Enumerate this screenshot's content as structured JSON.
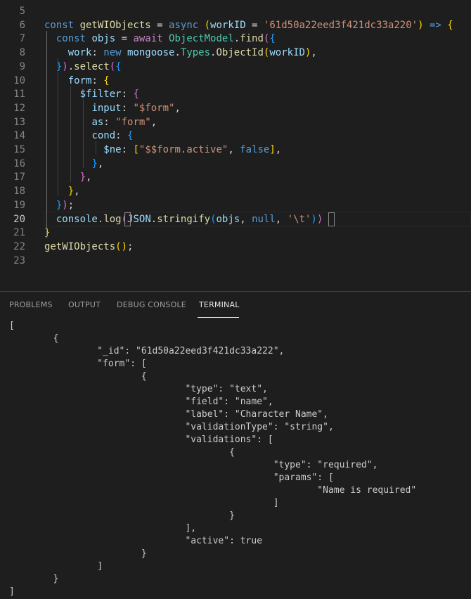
{
  "editor": {
    "active_line": "20",
    "lines": [
      {
        "num": "5",
        "tokens": []
      },
      {
        "num": "6",
        "tokens": [
          [
            "kw",
            "const "
          ],
          [
            "fn",
            "getWIObjects"
          ],
          [
            "pun",
            " = "
          ],
          [
            "kw",
            "async "
          ],
          [
            "b1",
            "("
          ],
          [
            "var",
            "workID"
          ],
          [
            "pun",
            " = "
          ],
          [
            "str",
            "'61d50a22eed3f421dc33a220'"
          ],
          [
            "b1",
            ")"
          ],
          [
            "kw",
            " => "
          ],
          [
            "b1",
            "{"
          ]
        ]
      },
      {
        "num": "7",
        "tokens": [
          [
            "pun",
            "  "
          ],
          [
            "kw",
            "const "
          ],
          [
            "var",
            "objs"
          ],
          [
            "pun",
            " = "
          ],
          [
            "ctl",
            "await "
          ],
          [
            "cls",
            "ObjectModel"
          ],
          [
            "pun",
            "."
          ],
          [
            "fn",
            "find"
          ],
          [
            "b2",
            "("
          ],
          [
            "b3",
            "{"
          ]
        ]
      },
      {
        "num": "8",
        "tokens": [
          [
            "pun",
            "    "
          ],
          [
            "var",
            "work"
          ],
          [
            "pun",
            ": "
          ],
          [
            "kw",
            "new "
          ],
          [
            "var",
            "mongoose"
          ],
          [
            "pun",
            "."
          ],
          [
            "cls",
            "Types"
          ],
          [
            "pun",
            "."
          ],
          [
            "fn",
            "ObjectId"
          ],
          [
            "b1",
            "("
          ],
          [
            "var",
            "workID"
          ],
          [
            "b1",
            ")"
          ],
          [
            "pun",
            ","
          ]
        ]
      },
      {
        "num": "9",
        "tokens": [
          [
            "pun",
            "  "
          ],
          [
            "b3",
            "}"
          ],
          [
            "b2",
            ")"
          ],
          [
            "pun",
            "."
          ],
          [
            "fn",
            "select"
          ],
          [
            "b2",
            "("
          ],
          [
            "b3",
            "{"
          ]
        ]
      },
      {
        "num": "10",
        "tokens": [
          [
            "pun",
            "    "
          ],
          [
            "var",
            "form"
          ],
          [
            "pun",
            ": "
          ],
          [
            "b1",
            "{"
          ]
        ]
      },
      {
        "num": "11",
        "tokens": [
          [
            "pun",
            "      "
          ],
          [
            "var",
            "$filter"
          ],
          [
            "pun",
            ": "
          ],
          [
            "b2",
            "{"
          ]
        ]
      },
      {
        "num": "12",
        "tokens": [
          [
            "pun",
            "        "
          ],
          [
            "var",
            "input"
          ],
          [
            "pun",
            ": "
          ],
          [
            "str",
            "\"$form\""
          ],
          [
            "pun",
            ","
          ]
        ]
      },
      {
        "num": "13",
        "tokens": [
          [
            "pun",
            "        "
          ],
          [
            "var",
            "as"
          ],
          [
            "pun",
            ": "
          ],
          [
            "str",
            "\"form\""
          ],
          [
            "pun",
            ","
          ]
        ]
      },
      {
        "num": "14",
        "tokens": [
          [
            "pun",
            "        "
          ],
          [
            "var",
            "cond"
          ],
          [
            "pun",
            ": "
          ],
          [
            "b3",
            "{"
          ]
        ]
      },
      {
        "num": "15",
        "tokens": [
          [
            "pun",
            "          "
          ],
          [
            "var",
            "$ne"
          ],
          [
            "pun",
            ": "
          ],
          [
            "b1",
            "["
          ],
          [
            "str",
            "\"$$form.active\""
          ],
          [
            "pun",
            ", "
          ],
          [
            "kw",
            "false"
          ],
          [
            "b1",
            "]"
          ],
          [
            "pun",
            ","
          ]
        ]
      },
      {
        "num": "16",
        "tokens": [
          [
            "pun",
            "        "
          ],
          [
            "b3",
            "}"
          ],
          [
            "pun",
            ","
          ]
        ]
      },
      {
        "num": "17",
        "tokens": [
          [
            "pun",
            "      "
          ],
          [
            "b2",
            "}"
          ],
          [
            "pun",
            ","
          ]
        ]
      },
      {
        "num": "18",
        "tokens": [
          [
            "pun",
            "    "
          ],
          [
            "b1",
            "}"
          ],
          [
            "pun",
            ","
          ]
        ]
      },
      {
        "num": "19",
        "tokens": [
          [
            "pun",
            "  "
          ],
          [
            "b3",
            "}"
          ],
          [
            "b2",
            ")"
          ],
          [
            "pun",
            ";"
          ]
        ]
      },
      {
        "num": "20",
        "tokens": [
          [
            "pun",
            "  "
          ],
          [
            "var",
            "console"
          ],
          [
            "pun",
            "."
          ],
          [
            "fn",
            "log"
          ],
          [
            "b2",
            "("
          ],
          [
            "var",
            "JSON"
          ],
          [
            "pun",
            "."
          ],
          [
            "fn",
            "stringify"
          ],
          [
            "b3",
            "("
          ],
          [
            "var",
            "objs"
          ],
          [
            "pun",
            ", "
          ],
          [
            "kw",
            "null"
          ],
          [
            "pun",
            ", "
          ],
          [
            "str",
            "'\\t'"
          ],
          [
            "b3",
            ")"
          ],
          [
            "b2",
            ")"
          ]
        ]
      },
      {
        "num": "21",
        "tokens": [
          [
            "b1",
            "}"
          ]
        ]
      },
      {
        "num": "22",
        "tokens": [
          [
            "fn",
            "getWIObjects"
          ],
          [
            "b1",
            "("
          ],
          [
            "b1",
            ")"
          ],
          [
            "pun",
            ";"
          ]
        ]
      },
      {
        "num": "23",
        "tokens": []
      }
    ]
  },
  "panel": {
    "tabs": [
      {
        "label": "PROBLEMS",
        "active": false
      },
      {
        "label": "OUTPUT",
        "active": false
      },
      {
        "label": "DEBUG CONSOLE",
        "active": false
      },
      {
        "label": "TERMINAL",
        "active": true
      }
    ],
    "terminal_output": "[\n\t{\n\t\t\"_id\": \"61d50a22eed3f421dc33a222\",\n\t\t\"form\": [\n\t\t\t{\n\t\t\t\t\"type\": \"text\",\n\t\t\t\t\"field\": \"name\",\n\t\t\t\t\"label\": \"Character Name\",\n\t\t\t\t\"validationType\": \"string\",\n\t\t\t\t\"validations\": [\n\t\t\t\t\t{\n\t\t\t\t\t\t\"type\": \"required\",\n\t\t\t\t\t\t\"params\": [\n\t\t\t\t\t\t\t\"Name is required\"\n\t\t\t\t\t\t]\n\t\t\t\t\t}\n\t\t\t\t],\n\t\t\t\t\"active\": true\n\t\t\t}\n\t\t]\n\t}\n]"
  }
}
